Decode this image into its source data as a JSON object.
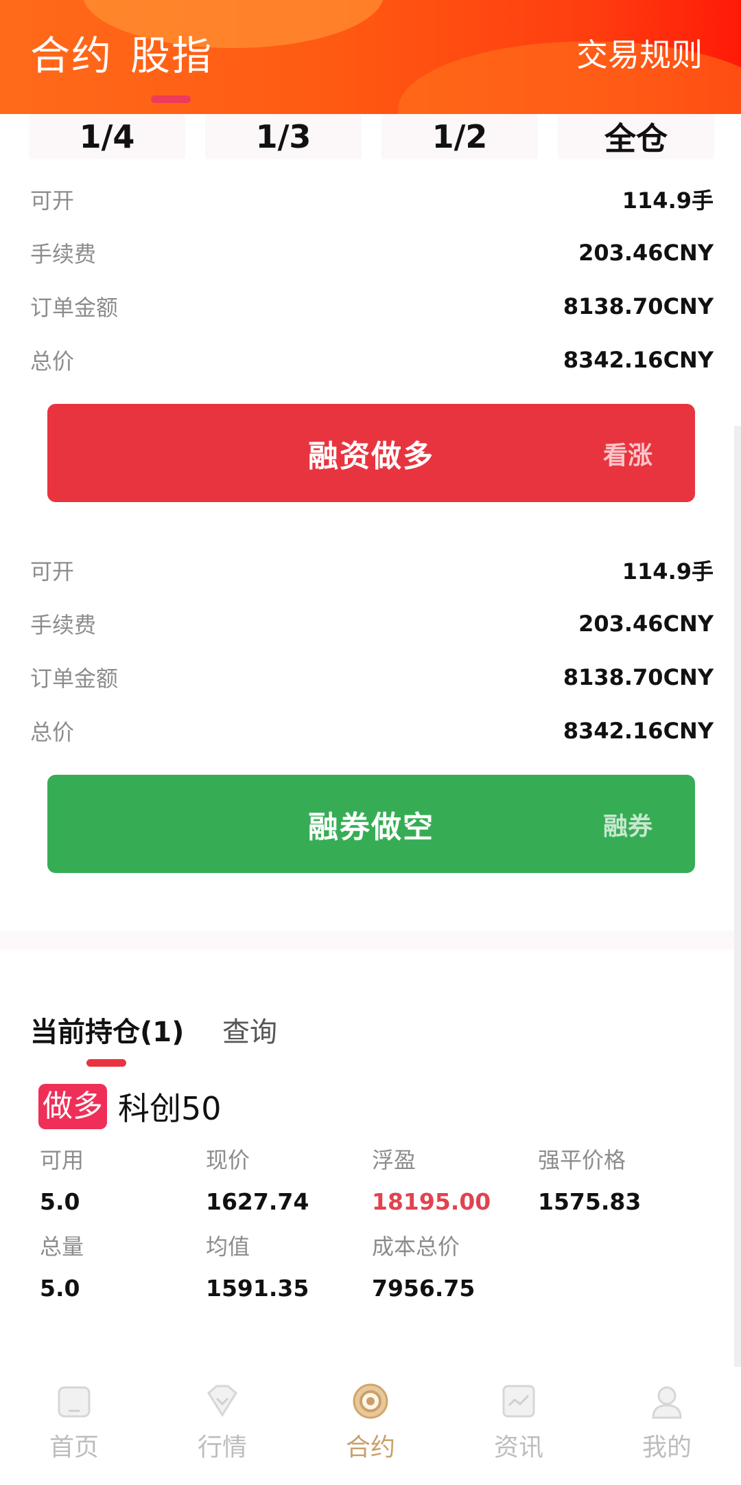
{
  "header": {
    "tab_contract": "合约",
    "tab_index": "股指",
    "rules_link": "交易规则",
    "colors": {
      "gradient_start": "#ff6a1a",
      "gradient_end": "#ff1a08",
      "indicator": "#ee3a5b"
    }
  },
  "ratios": [
    "1/4",
    "1/3",
    "1/2",
    "全仓"
  ],
  "long_section": {
    "rows": [
      {
        "label": "可开",
        "value": "114.9手"
      },
      {
        "label": "手续费",
        "value": "203.46CNY"
      },
      {
        "label": "订单金额",
        "value": "8138.70CNY"
      },
      {
        "label": "总价",
        "value": "8342.16CNY"
      }
    ],
    "button": {
      "label": "融资做多",
      "sub": "看涨",
      "color": "#e8343f"
    }
  },
  "short_section": {
    "rows": [
      {
        "label": "可开",
        "value": "114.9手"
      },
      {
        "label": "手续费",
        "value": "203.46CNY"
      },
      {
        "label": "订单金额",
        "value": "8138.70CNY"
      },
      {
        "label": "总价",
        "value": "8342.16CNY"
      }
    ],
    "button": {
      "label": "融券做空",
      "sub": "融券",
      "color": "#36ad55"
    }
  },
  "positions": {
    "tab_current": "当前持仓(1)",
    "tab_query": "查询",
    "item": {
      "direction": "做多",
      "name": "科创50",
      "fields": [
        {
          "label": "可用",
          "value": "5.0"
        },
        {
          "label": "现价",
          "value": "1627.74"
        },
        {
          "label": "浮盈",
          "value": "18195.00"
        },
        {
          "label": "强平价格",
          "value": "1575.83"
        },
        {
          "label": "总量",
          "value": "5.0"
        },
        {
          "label": "均值",
          "value": "1591.35"
        },
        {
          "label": "成本总价",
          "value": "7956.75"
        }
      ]
    }
  },
  "bottom_nav": {
    "items": [
      {
        "label": "首页",
        "icon": "home-icon"
      },
      {
        "label": "行情",
        "icon": "diamond-icon"
      },
      {
        "label": "合约",
        "icon": "contract-icon",
        "active": true
      },
      {
        "label": "资讯",
        "icon": "news-chart-icon"
      },
      {
        "label": "我的",
        "icon": "profile-icon"
      }
    ],
    "active_color": "#c9a06b"
  }
}
